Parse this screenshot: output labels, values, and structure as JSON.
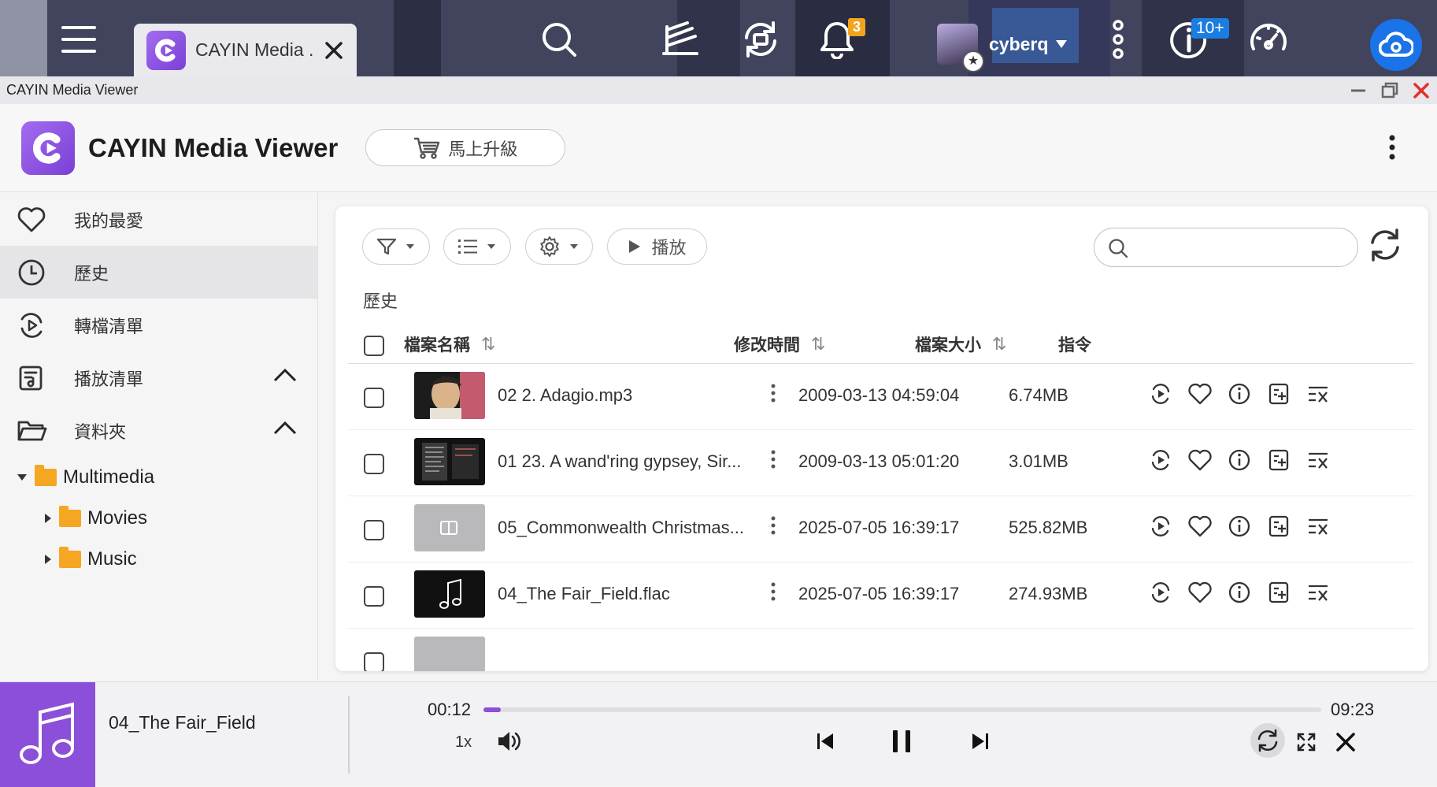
{
  "taskbar": {
    "tab_label": "CAYIN Media ...",
    "notification_count": "3",
    "user": "cyberq",
    "updates_badge": "10+"
  },
  "window": {
    "title": "CAYIN Media Viewer"
  },
  "app": {
    "title": "CAYIN Media Viewer",
    "upgrade_label": "馬上升級"
  },
  "sidebar": {
    "items": [
      {
        "label": "我的最愛",
        "icon": "heart-icon"
      },
      {
        "label": "歷史",
        "icon": "clock-icon",
        "active": true
      },
      {
        "label": "轉檔清單",
        "icon": "transcode-icon"
      },
      {
        "label": "播放清單",
        "icon": "playlist-icon"
      },
      {
        "label": "資料夾",
        "icon": "folder-icon"
      }
    ],
    "tree": {
      "root": "Multimedia",
      "children": [
        "Movies",
        "Music"
      ]
    }
  },
  "toolbar": {
    "play_label": "播放",
    "search_placeholder": ""
  },
  "section_title": "歷史",
  "table": {
    "columns": [
      "檔案名稱",
      "修改時間",
      "檔案大小",
      "指令"
    ],
    "rows": [
      {
        "name": "02 2. Adagio.mp3",
        "modified": "2009-03-13 04:59:04",
        "size": "6.74MB",
        "thumb": "portrait"
      },
      {
        "name": "01 23. A wand'ring gypsey, Sir...",
        "modified": "2009-03-13 05:01:20",
        "size": "3.01MB",
        "thumb": "document"
      },
      {
        "name": "05_Commonwealth Christmas...",
        "modified": "2025-07-05 16:39:17",
        "size": "525.82MB",
        "thumb": "video"
      },
      {
        "name": "04_The Fair_Field.flac",
        "modified": "2025-07-05 16:39:17",
        "size": "274.93MB",
        "thumb": "music"
      }
    ]
  },
  "player": {
    "title": "04_The Fair_Field",
    "current_time": "00:12",
    "total_time": "09:23",
    "progress_fraction": 0.021,
    "speed": "1x"
  },
  "colors": {
    "accent": "#8c4fd9",
    "cloud": "#1a73e8",
    "badge_orange": "#f2a51c"
  }
}
